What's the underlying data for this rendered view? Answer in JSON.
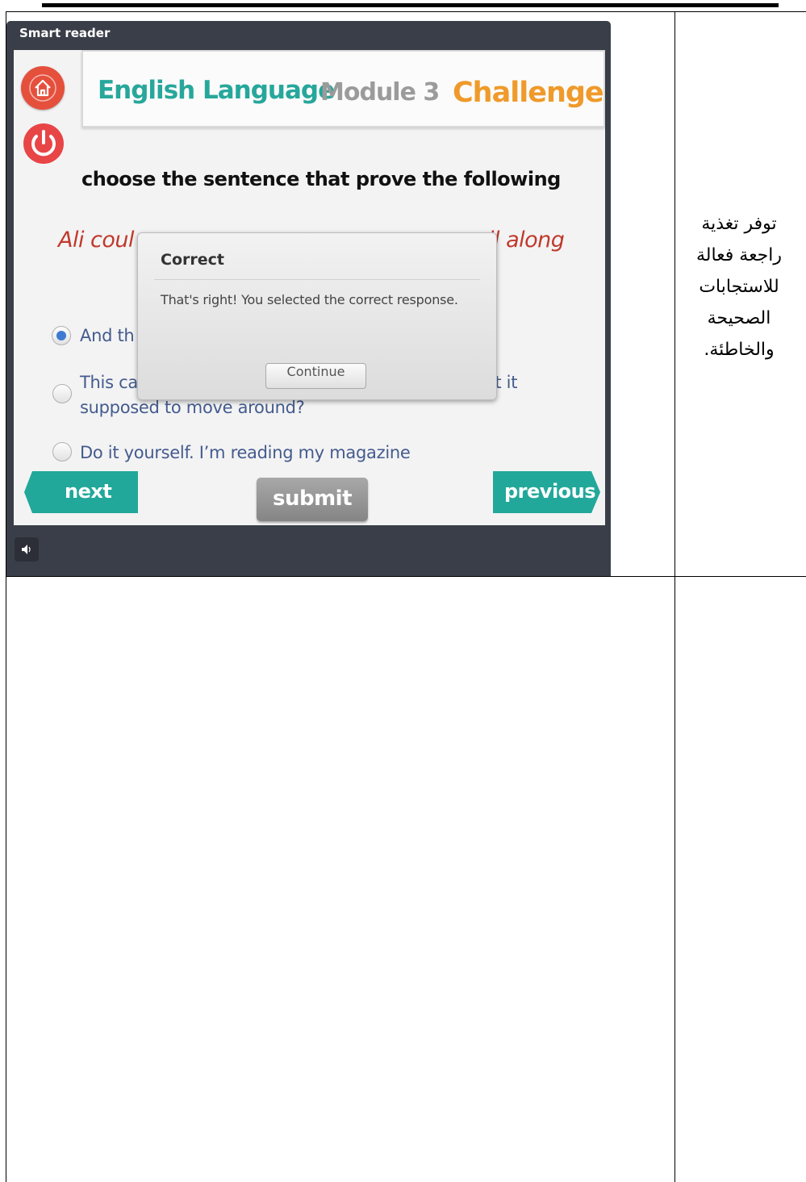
{
  "app": {
    "title": "Smart reader",
    "header": {
      "subject": "English Language",
      "module": "Module 3",
      "section": "Challenge"
    },
    "question": "choose the sentence that prove the following",
    "statement_left": "Ali coul",
    "statement_right": "ll along",
    "options": [
      {
        "line1": "And th",
        "checked": true
      },
      {
        "line1_left": "This ca",
        "line1_right": "’t it",
        "line2": "supposed to move around?",
        "checked": false
      },
      {
        "line1": "Do it yourself. I’m reading my magazine",
        "checked": false
      }
    ],
    "buttons": {
      "next": "next",
      "submit": "submit",
      "previous": "previous"
    },
    "dialog": {
      "title": "Correct",
      "message": "That's right!  You selected the correct response.",
      "button": "Continue"
    },
    "icons": {
      "home": "home-icon",
      "power": "power-icon",
      "sound": "speaker-icon"
    },
    "colors": {
      "teal": "#27a79b",
      "orange": "#ef9a2b",
      "red": "#e5503d",
      "statement": "#c0392b"
    }
  },
  "description_cell": "توفر تغذية راجعة فعالة للاستجابات الصحيحة والخاطئة."
}
